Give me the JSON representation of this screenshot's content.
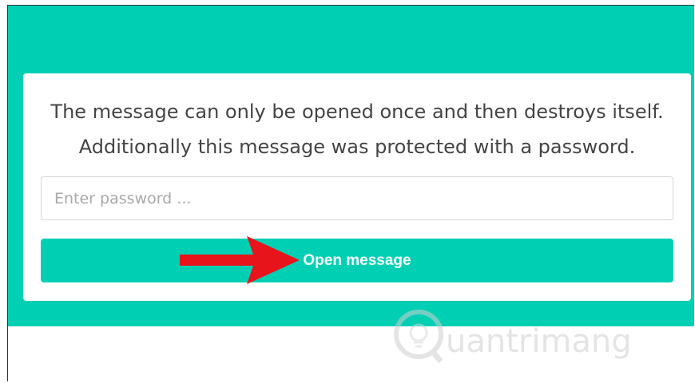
{
  "card": {
    "message_line1": "The message can only be opened once and then destroys itself.",
    "message_line2": "Additionally this message was protected with a password."
  },
  "password": {
    "placeholder": "Enter password ...",
    "value": ""
  },
  "open_button": {
    "label": "Open message"
  },
  "annotation": {
    "arrow_color": "#e8141b"
  },
  "watermark": {
    "text": "uantrimang"
  },
  "colors": {
    "accent": "#00cfb4"
  }
}
